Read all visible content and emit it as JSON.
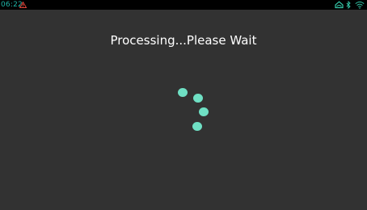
{
  "status_bar": {
    "time": "06:22",
    "time_color": "#1fb5a8",
    "warning_icon": "warning-triangle-icon",
    "warning_color": "#e0453a",
    "right_icons": [
      "cloud-home-icon",
      "bluetooth-icon",
      "wifi-icon"
    ],
    "right_icon_color": "#35c7a8"
  },
  "main": {
    "title": "Processing...Please Wait",
    "title_color": "#ffffff",
    "spinner_icon": "loading-spinner-icon",
    "spinner_color": "#6fe0c4"
  }
}
